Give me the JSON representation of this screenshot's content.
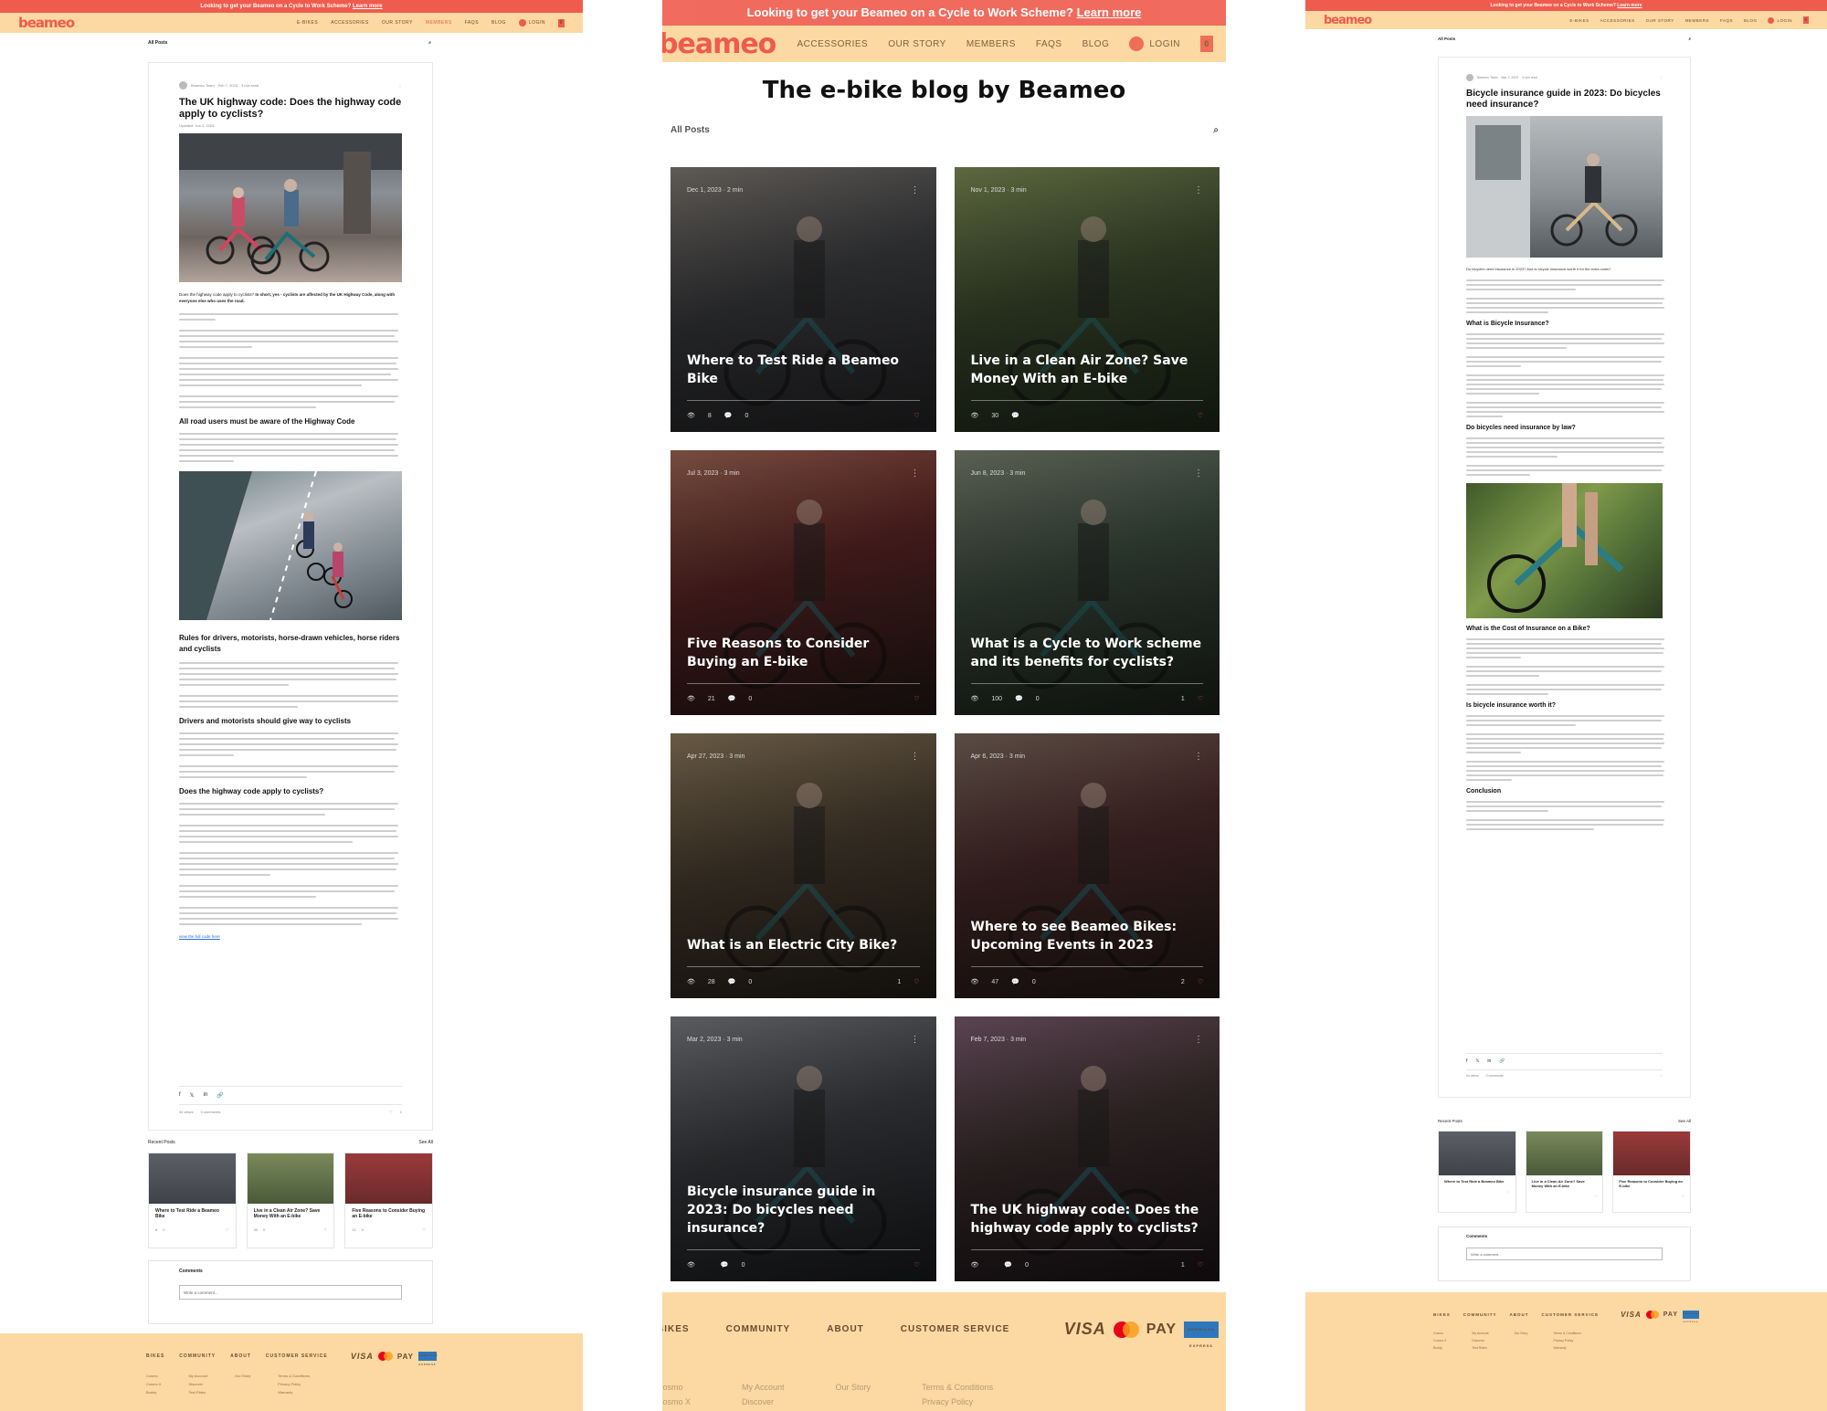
{
  "common": {
    "banner": "Looking to get your Beameo on a Cycle to Work Scheme?",
    "banner_link": "Learn more",
    "logo": "beameo",
    "nav": [
      "E-BIKES",
      "ACCESSORIES",
      "OUR STORY",
      "MEMBERS",
      "FAQS",
      "BLOG"
    ],
    "login": "LOGIN",
    "cart_count": "0",
    "all_posts": "All Posts",
    "footer_heads": [
      "BIKES",
      "COMMUNITY",
      "ABOUT",
      "CUSTOMER SERVICE"
    ],
    "footer_bikes": [
      "Cosmo",
      "Cosmo X",
      "Buddy"
    ],
    "footer_community": [
      "My Account",
      "Discover",
      "Test Rides"
    ],
    "footer_about": [
      "Our Story"
    ],
    "footer_service": [
      "Terms & Conditions",
      "Privacy Policy",
      "Warranty"
    ],
    "pay_visa": "VISA",
    "pay_apple": "Pay",
    "pay_amex": "AMERICAN EXPRESS",
    "comments": "Comments",
    "write_comment": "Write a comment...",
    "recent_posts": "Recent Posts",
    "see_all": "See All"
  },
  "left": {
    "author": "Beameo Team",
    "date": "Feb 7, 2023",
    "read": "3 min read",
    "title": "The UK highway code: Does the highway code apply to cyclists?",
    "updated": "Updated: Jun 2, 2023",
    "intro_q": "Does the highway code apply to cyclists?",
    "intro_a": "In short, yes - cyclists are affected by the UK Highway Code, along with everyone else who uses the road.",
    "h_road_users": "All road users must be aware of the Highway Code",
    "h_rules": "Rules for drivers, motorists, horse-drawn vehicles, horse riders and cyclists",
    "h_give_way": "Drivers and motorists should give way to cyclists",
    "h_apply": "Does the highway code apply to cyclists?",
    "read_link": "view the full code here",
    "views": "34 views",
    "comments": "0 comments",
    "likes": "1",
    "recent": [
      {
        "title": "Where to Test Ride a Beameo Bike",
        "views": "8",
        "comments": "0"
      },
      {
        "title": "Live in a Clean Air Zone? Save Money With an E-bike",
        "views": "30",
        "comments": "0"
      },
      {
        "title": "Five Reasons to Consider Buying an E-bike",
        "views": "21",
        "comments": "0"
      }
    ]
  },
  "mid": {
    "heading": "The e-bike blog by Beameo",
    "cards": [
      {
        "date": "Dec 1, 2023",
        "read": "2 min",
        "title": "Where to Test Ride a Beameo Bike",
        "views": "8",
        "comments": "0",
        "likes": ""
      },
      {
        "date": "Nov 1, 2023",
        "read": "3 min",
        "title": "Live in a Clean Air Zone? Save Money With an E-bike",
        "views": "30",
        "comments": "",
        "likes": ""
      },
      {
        "date": "Jul 3, 2023",
        "read": "3 min",
        "title": "Five Reasons to Consider Buying an E-bike",
        "views": "21",
        "comments": "0",
        "likes": ""
      },
      {
        "date": "Jun 8, 2023",
        "read": "3 min",
        "title": "What is a Cycle to Work scheme and its benefits for cyclists?",
        "views": "100",
        "comments": "0",
        "likes": "1"
      },
      {
        "date": "Apr 27, 2023",
        "read": "3 min",
        "title": "What is an Electric City Bike?",
        "views": "28",
        "comments": "0",
        "likes": "1"
      },
      {
        "date": "Apr 6, 2023",
        "read": "3 min",
        "title": "Where to see Beameo Bikes: Upcoming Events in 2023",
        "views": "47",
        "comments": "0",
        "likes": "2"
      },
      {
        "date": "Mar 2, 2023",
        "read": "3 min",
        "title": "Bicycle insurance guide in 2023: Do bicycles need insurance?",
        "views": "",
        "comments": "0",
        "likes": ""
      },
      {
        "date": "Feb 7, 2023",
        "read": "3 min",
        "title": "The UK highway code: Does the highway code apply to cyclists?",
        "views": "",
        "comments": "0",
        "likes": "1"
      }
    ]
  },
  "right": {
    "author": "Beameo Team",
    "date": "Mar 2, 2023",
    "read": "3 min read",
    "title": "Bicycle insurance guide in 2023: Do bicycles need insurance?",
    "q1": "Do bicycles need insurance in 2023? And is bicycle insurance worth it for the extra costs?",
    "h_what": "What is Bicycle Insurance?",
    "h_law": "Do bicycles need insurance by law?",
    "h_cost": "What is the Cost of Insurance on a Bike?",
    "h_worth": "Is bicycle insurance worth it?",
    "h_conclusion": "Conclusion",
    "views": "54 views",
    "comments": "0 comments",
    "recent": [
      {
        "title": "Where to Test Ride a Beameo Bike"
      },
      {
        "title": "Live in a Clean Air Zone? Save Money With an E-bike"
      },
      {
        "title": "Five Reasons to Consider Buying an E-bike"
      }
    ]
  }
}
